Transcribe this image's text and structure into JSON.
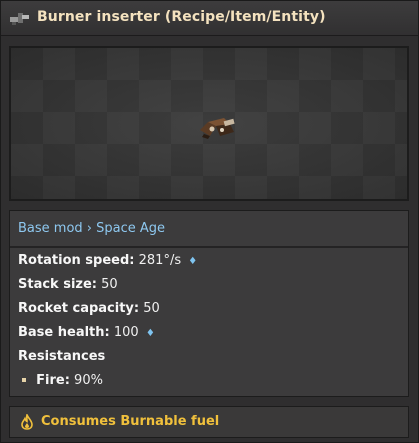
{
  "window": {
    "title": "Burner inserter (Recipe/Item/Entity)",
    "title_icon": "burner-inserter-icon"
  },
  "preview": {
    "sprite": "burner-inserter-sprite"
  },
  "info": {
    "mod_text": "Base mod › Space Age",
    "rotation_label": "Rotation speed:",
    "rotation_value": "281°/s",
    "stack_label": "Stack size:",
    "stack_value": "50",
    "rocket_label": "Rocket capacity:",
    "rocket_value": "50",
    "health_label": "Base health:",
    "health_value": "100",
    "resistances_label": "Resistances",
    "fire_label": "Fire:",
    "fire_value": "90%",
    "quality_diamond": "♦"
  },
  "fuel": {
    "icon": "flame-icon",
    "text": "Consumes Burnable fuel"
  },
  "colors": {
    "title": "#f4e2bf",
    "mod_link": "#8ec8f0",
    "fuel_text": "#f0c03c",
    "panel_bg": "#3c3b3c"
  }
}
